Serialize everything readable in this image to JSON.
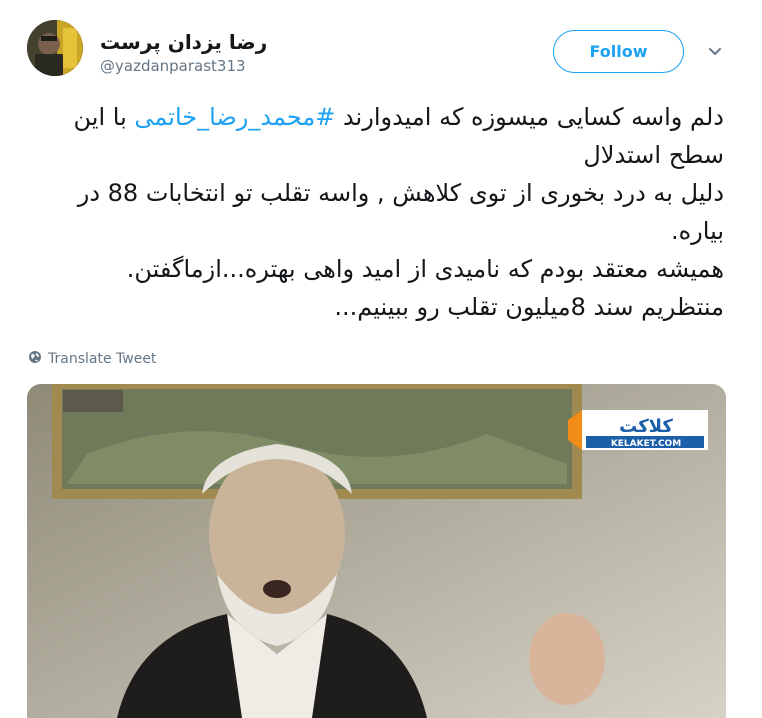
{
  "author": {
    "display_name": "رضا یزدان پرست",
    "handle": "@yazdanparast313"
  },
  "actions": {
    "follow_label": "Follow"
  },
  "icons": {
    "caret": "chevron-down-icon",
    "translate": "globe-icon"
  },
  "tweet": {
    "text_before": "دلم واسه کسایی میسوزه که امیدوارند ",
    "hashtag": "#محمد_رضا_خاتمی",
    "text_after_lines": [
      " با این سطح استدلال",
      "دلیل به درد بخوری از توی کلاهش , واسه تقلب تو انتخابات 88 در بیاره.",
      "همیشه معتقد بودم که نامیدی از امید واهی بهتره...ازماگفتن.",
      "منتظریم سند 8میلیون تقلب رو ببینیم..."
    ],
    "translate_label": "Translate Tweet"
  },
  "media": {
    "watermark_text": "KELAKET.COM",
    "watermark_brand": "کلاکت"
  },
  "colors": {
    "accent": "#1da1f2",
    "secondary_text": "#657786",
    "primary_text": "#14171a"
  }
}
